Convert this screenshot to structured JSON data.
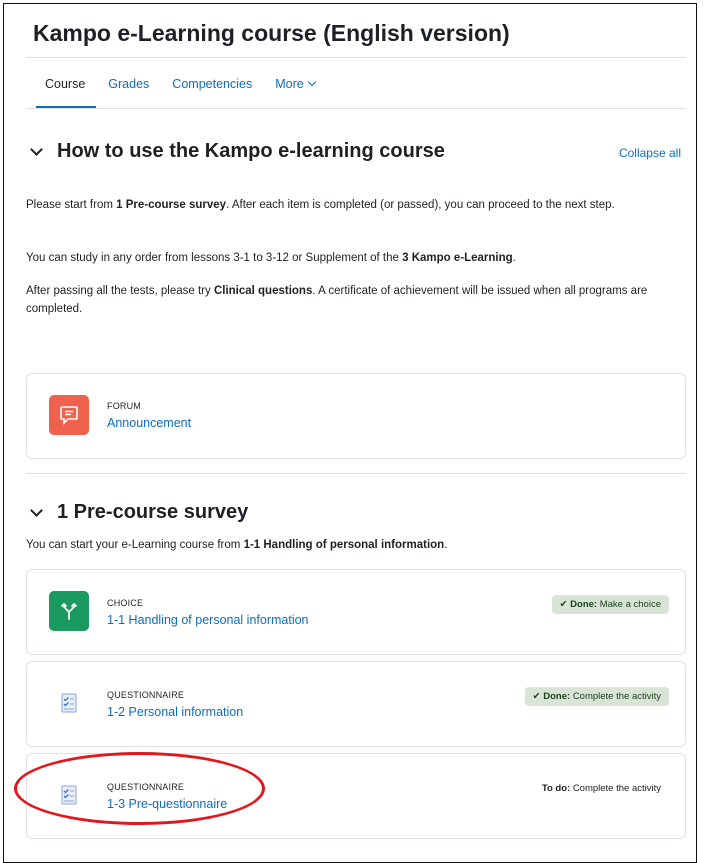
{
  "page": {
    "title": "Kampo e-Learning course (English version)"
  },
  "tabs": [
    {
      "label": "Course",
      "active": true
    },
    {
      "label": "Grades",
      "active": false
    },
    {
      "label": "Competencies",
      "active": false
    },
    {
      "label": "More",
      "active": false
    }
  ],
  "collapse_all": "Collapse all",
  "section0": {
    "title": "How to use the Kampo e-learning course",
    "p1_a": "Please start from ",
    "p1_b": "1 Pre-course survey",
    "p1_c": ". After each item is completed (or passed), you can proceed to the next step.",
    "p2_a": "You can study in any order from lessons 3-1 to 3-12 or Supplement of the ",
    "p2_b": "3 Kampo e-Learning",
    "p2_c": ".",
    "p3_a": "After passing all the tests, please try ",
    "p3_b": "Clinical questions",
    "p3_c": ". A certificate of achievement will be issued when all programs are completed.",
    "activity": {
      "type": "Forum",
      "name": "Announcement",
      "icon": "forum-icon",
      "color": "#f0624d"
    }
  },
  "section1": {
    "title": "1 Pre-course survey",
    "desc_a": "You can start your e-Learning course from ",
    "desc_b": "1-1 Handling of personal information",
    "desc_c": ".",
    "activities": [
      {
        "type": "Choice",
        "name": "1-1 Handling of personal information",
        "icon": "choice-icon",
        "color": "#1a9a5e",
        "status_label": "Done:",
        "status_text": "Make a choice",
        "status": "done"
      },
      {
        "type": "Questionnaire",
        "name": "1-2 Personal information",
        "icon": "questionnaire-icon",
        "status_label": "Done:",
        "status_text": "Complete the activity",
        "status": "done"
      },
      {
        "type": "Questionnaire",
        "name": "1-3 Pre-questionnaire",
        "icon": "questionnaire-icon",
        "status_label": "To do:",
        "status_text": "Complete the activity",
        "status": "todo"
      }
    ]
  },
  "annotation": {
    "color": "#e2161c"
  }
}
